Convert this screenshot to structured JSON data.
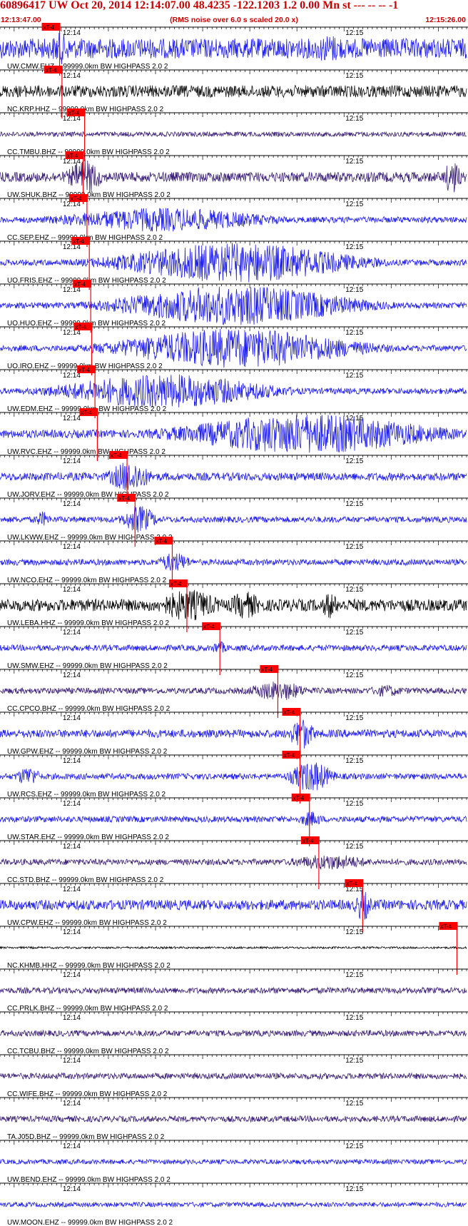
{
  "header": {
    "title": "60896417 UW Oct 20, 2014 12:14:07.00   48.4235 -122.1203  1.2 0.00 Mn st --- -- --  -1",
    "subtitle": "(RMS noise over 6.0 s scaled 20.0 x)",
    "start_time": "12:13:47.00",
    "end_time": "12:15:26.00"
  },
  "chart_data": {
    "type": "line",
    "title": "60896417 UW Oct 20, 2014 12:14:07.00   48.4235 -122.1203  1.2 0.00 Mn st --- -- --  -1",
    "subtitle": "(RMS noise over 6.0 s scaled 20.0 x)",
    "x_unit": "seconds after 12:13:47.00",
    "xlim": [
      0,
      99
    ],
    "minute_tick_labels": [
      {
        "label": "12:14",
        "t": 13
      },
      {
        "label": "12:15",
        "t": 73
      }
    ],
    "pick_label": "xT-4",
    "series": [
      {
        "name": "UW.CMW.EHZ -- 99999.0km BW  HIGHPASS  2.0  2",
        "color": "#1f1fef",
        "pick_t": 12.5,
        "amplitude": 0.5,
        "events": [
          [
            12.8,
            0.8,
            6
          ],
          [
            70,
            0.7,
            12
          ],
          [
            95,
            0.5,
            10
          ]
        ]
      },
      {
        "name": "NC.KRP.HHZ -- 99999.0km BW  HIGHPASS  2.0  2",
        "color": "#111111",
        "pick_t": 13,
        "amplitude": 0.3,
        "events": [
          [
            62,
            0.3,
            20
          ]
        ]
      },
      {
        "name": "CC.TMBU.BHZ -- 99999.0km BW  HIGHPASS  2.0  2",
        "color": "#3a1f78",
        "pick_t": 17.8,
        "amplitude": 0.12,
        "events": []
      },
      {
        "name": "UW.SHUK.BHZ -- 99999.0km BW  HIGHPASS  2.0  2",
        "color": "#3a1f78",
        "pick_t": 17.5,
        "amplitude": 0.25,
        "events": [
          [
            18,
            0.9,
            8
          ],
          [
            96,
            0.9,
            4
          ]
        ]
      },
      {
        "name": "CC.SEP.EHZ -- 99999.0km BW  HIGHPASS  2.0  2",
        "color": "#1f1fef",
        "pick_t": 18.3,
        "amplitude": 0.15,
        "events": [
          [
            35,
            0.6,
            50
          ]
        ]
      },
      {
        "name": "UO.FRIS.EHZ -- 99999.0km BW  HIGHPASS  2.0  2",
        "color": "#1f1fef",
        "pick_t": 18.8,
        "amplitude": 0.15,
        "events": [
          [
            50,
            1,
            55
          ]
        ]
      },
      {
        "name": "UO.HUO.EHZ -- 99999.0km BW  HIGHPASS  2.0  2",
        "color": "#1f1fef",
        "pick_t": 19.1,
        "amplitude": 0.15,
        "events": [
          [
            50,
            1,
            55
          ]
        ]
      },
      {
        "name": "UO.IRO.EHZ -- 99999.0km BW  HIGHPASS  2.0  2",
        "color": "#1f1fef",
        "pick_t": 19.3,
        "amplitude": 0.15,
        "events": [
          [
            50,
            1,
            55
          ]
        ]
      },
      {
        "name": "UW.EDM.EHZ -- 99999.0km BW  HIGHPASS  2.0  2",
        "color": "#1f1fef",
        "pick_t": 20,
        "amplitude": 0.15,
        "events": [
          [
            35,
            0.85,
            50
          ]
        ]
      },
      {
        "name": "UW.RVC.EHZ -- 99999.0km BW  HIGHPASS  2.0  2",
        "color": "#1f1fef",
        "pick_t": 20.5,
        "amplitude": 0.2,
        "events": [
          [
            65,
            1,
            60
          ]
        ]
      },
      {
        "name": "UW.JORV.EHZ -- 99999.0km BW  HIGHPASS  2.0  2",
        "color": "#1f1fef",
        "pick_t": 26.8,
        "amplitude": 0.2,
        "events": [
          [
            27.5,
            0.8,
            10
          ]
        ]
      },
      {
        "name": "UW.LKWW.EHZ -- 99999.0km BW  HIGHPASS  2.0  2",
        "color": "#1f1fef",
        "pick_t": 28.5,
        "amplitude": 0.15,
        "events": [
          [
            9,
            0.4,
            4
          ],
          [
            29.5,
            0.7,
            8
          ]
        ]
      },
      {
        "name": "UW.NCO.EHZ -- 99999.0km BW  HIGHPASS  2.0  2",
        "color": "#1f1fef",
        "pick_t": 36.4,
        "amplitude": 0.15,
        "events": [
          [
            37,
            0.5,
            8
          ]
        ]
      },
      {
        "name": "UW.LEBA.HHZ -- 99999.0km BW  HIGHPASS  2.0  2",
        "color": "#000000",
        "pick_t": 39.5,
        "amplitude": 0.3,
        "events": [
          [
            40,
            0.8,
            15
          ],
          [
            52,
            0.7,
            8
          ],
          [
            70,
            0.7,
            4
          ]
        ]
      },
      {
        "name": "UW.SMW.EHZ -- 99999.0km BW  HIGHPASS  2.0  2",
        "color": "#1f1fef",
        "pick_t": 46.5,
        "amplitude": 0.15,
        "events": [
          [
            46.5,
            0.35,
            4
          ]
        ]
      },
      {
        "name": "CC.CPCO.BHZ -- 99999.0km BW  HIGHPASS  2.0  2",
        "color": "#3a1f78",
        "pick_t": 58.8,
        "amplitude": 0.15,
        "events": [
          [
            59,
            0.5,
            14
          ],
          [
            82,
            0.3,
            10
          ]
        ]
      },
      {
        "name": "UW.GPW.EHZ -- 99999.0km BW  HIGHPASS  2.0  2",
        "color": "#1f1fef",
        "pick_t": 63.5,
        "amplitude": 0.2,
        "events": [
          [
            64,
            0.8,
            6
          ]
        ]
      },
      {
        "name": "UW.RCS.EHZ -- 99999.0km BW  HIGHPASS  2.0  2",
        "color": "#1f1fef",
        "pick_t": 63.5,
        "amplitude": 0.15,
        "events": [
          [
            6,
            0.5,
            6
          ],
          [
            66,
            0.8,
            10
          ]
        ]
      },
      {
        "name": "UW.STAR.EHZ -- 99999.0km BW  HIGHPASS  2.0  2",
        "color": "#1f1fef",
        "pick_t": 65.5,
        "amplitude": 0.15,
        "events": [
          [
            66,
            0.4,
            6
          ]
        ]
      },
      {
        "name": "CC.STD.BHZ -- 99999.0km BW  HIGHPASS  2.0  2",
        "color": "#3a1f78",
        "pick_t": 67.5,
        "amplitude": 0.15,
        "events": [
          [
            70,
            0.4,
            20
          ]
        ]
      },
      {
        "name": "UW.CPW.EHZ -- 99999.0km BW  HIGHPASS  2.0  2",
        "color": "#1f1fef",
        "pick_t": 76.8,
        "amplitude": 0.25,
        "events": [
          [
            77,
            0.8,
            4
          ]
        ]
      },
      {
        "name": "NC.KHMB.HHZ -- 99999.0km BW  HIGHPASS  2.0  2",
        "color": "#000000",
        "pick_t": 96.8,
        "amplitude": 0.05,
        "events": []
      },
      {
        "name": "CC.PRLK.BHZ -- 99999.0km BW  HIGHPASS  2.0  2",
        "color": "#3a1f78",
        "pick_t": null,
        "amplitude": 0.15,
        "events": []
      },
      {
        "name": "CC.TCBU.BHZ -- 99999.0km BW  HIGHPASS  2.0  2",
        "color": "#3a1f78",
        "pick_t": null,
        "amplitude": 0.15,
        "events": []
      },
      {
        "name": "CC.WIFE.BHZ -- 99999.0km BW  HIGHPASS  2.0  2",
        "color": "#3a1f78",
        "pick_t": null,
        "amplitude": 0.15,
        "events": []
      },
      {
        "name": "TA.J05D.BHZ -- 99999.0km BW  HIGHPASS  2.0  2",
        "color": "#3a1f78",
        "pick_t": null,
        "amplitude": 0.15,
        "events": []
      },
      {
        "name": "UW.BEND.EHZ -- 99999.0km BW  HIGHPASS  2.0  2",
        "color": "#1f1fef",
        "pick_t": null,
        "amplitude": 0.12,
        "events": []
      },
      {
        "name": "UW.MOON.EHZ -- 99999.0km BW  HIGHPASS  2.0  2",
        "color": "#1f1fef",
        "pick_t": null,
        "amplitude": 0.12,
        "events": []
      }
    ],
    "pick_color": "#ff0000",
    "grid": false
  }
}
